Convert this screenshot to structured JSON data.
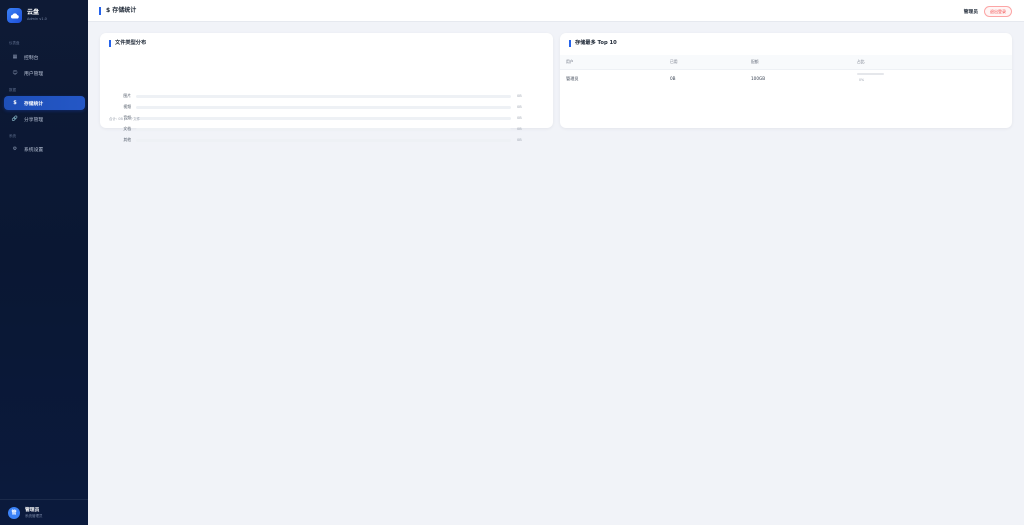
{
  "brand": {
    "title": "云盘",
    "version": "Admin v1.0"
  },
  "sidebar": {
    "sections": [
      {
        "label": "仪表盘",
        "items": [
          {
            "label": "控制台",
            "icon": "dashboard-icon"
          },
          {
            "label": "用户管理",
            "icon": "users-icon"
          }
        ]
      },
      {
        "label": "数据",
        "items": [
          {
            "label": "存储统计",
            "icon": "storage-icon",
            "active": true
          },
          {
            "label": "分享管理",
            "icon": "link-icon"
          }
        ]
      },
      {
        "label": "系统",
        "items": [
          {
            "label": "系统设置",
            "icon": "gear-icon"
          }
        ]
      }
    ],
    "user": {
      "avatar": "管",
      "name": "管理员",
      "role": "系统管理员"
    }
  },
  "header": {
    "title": "$ 存储统计",
    "user": "管理员",
    "logout_label": "退出登录"
  },
  "file_types": {
    "title": "文件类型分布",
    "rows": [
      {
        "label": "图片",
        "value": "0B",
        "fraction": 0
      },
      {
        "label": "视频",
        "value": "0B",
        "fraction": 0
      },
      {
        "label": "音频",
        "value": "0B",
        "fraction": 0
      },
      {
        "label": "文档",
        "value": "0B",
        "fraction": 0
      },
      {
        "label": "其他",
        "value": "0B",
        "fraction": 0
      }
    ],
    "footer": "合计: 0B | 0 个文件"
  },
  "top_users": {
    "title": "存储最多 Top 10",
    "columns": [
      "用户",
      "已用",
      "配额",
      "占比"
    ],
    "rows": [
      {
        "user": "管理员",
        "used": "0B",
        "quota": "100GB",
        "percent": "0%",
        "fraction": 0
      }
    ]
  },
  "colors": {
    "accent": "#2563eb",
    "sidebar_bg": "#0e1a35",
    "danger": "#ef4444"
  }
}
